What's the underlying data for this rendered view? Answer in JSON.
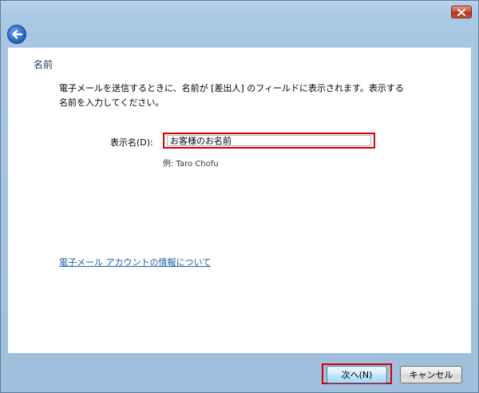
{
  "window": {
    "close_glyph": "×"
  },
  "heading": "名前",
  "description_line1": "電子メールを送信するときに、名前が [差出人] のフィールドに表示されます。表示する",
  "description_line2": "名前を入力してください。",
  "display_name": {
    "label": "表示名(D):",
    "value": "お客様のお名前",
    "example": "例: Taro Chofu"
  },
  "info_link": "電子メール アカウントの情報について",
  "buttons": {
    "next": "次へ(N)",
    "cancel": "キャンセル"
  },
  "icons": {
    "back": "back-arrow-icon",
    "close": "close-icon"
  },
  "colors": {
    "highlight": "#d40000",
    "link": "#1a5fa8",
    "heading": "#1e3a6e"
  }
}
